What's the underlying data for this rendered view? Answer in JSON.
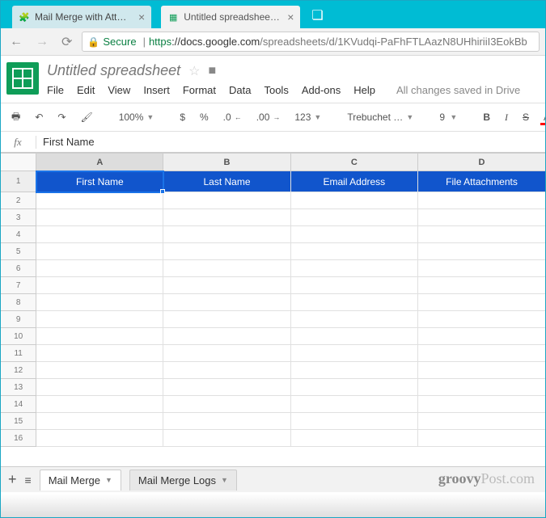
{
  "browser": {
    "tabs": [
      {
        "title": "Mail Merge with Attachm",
        "active": false
      },
      {
        "title": "Untitled spreadsheet - G",
        "active": true
      }
    ],
    "secure_label": "Secure",
    "url_scheme": "https",
    "url_host": "://docs.google.com",
    "url_path": "/spreadsheets/d/1KVudqi-PaFhFTLAazN8UHhiriiI3EokBb"
  },
  "doc": {
    "title": "Untitled spreadsheet",
    "menus": [
      "File",
      "Edit",
      "View",
      "Insert",
      "Format",
      "Data",
      "Tools",
      "Add-ons",
      "Help"
    ],
    "save_status": "All changes saved in Drive"
  },
  "toolbar": {
    "zoom": "100%",
    "currency": "$",
    "percent": "%",
    "dec_dec": ".0",
    "dec_inc": ".00",
    "more_fmt": "123",
    "font": "Trebuchet …",
    "size": "9",
    "bold": "B",
    "italic": "I",
    "strike": "S",
    "color": "A"
  },
  "formula": {
    "fx": "fx",
    "value": "First Name"
  },
  "grid": {
    "cols": [
      "A",
      "B",
      "C",
      "D"
    ],
    "header_row": [
      "First Name",
      "Last Name",
      "Email Address",
      "File Attachments"
    ],
    "row_count": 16
  },
  "sheets": {
    "tabs": [
      {
        "name": "Mail Merge",
        "active": true
      },
      {
        "name": "Mail Merge Logs",
        "active": false
      }
    ]
  },
  "watermark_bold": "groovy",
  "watermark_rest": "Post.com"
}
